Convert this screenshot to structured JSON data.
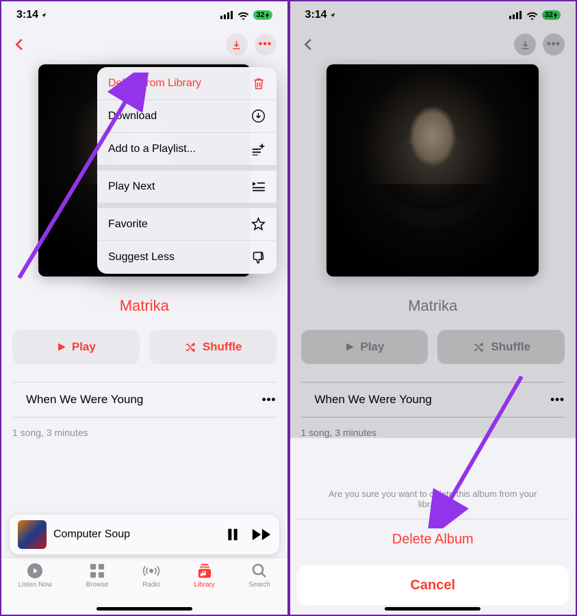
{
  "status": {
    "time": "3:14",
    "battery": "32"
  },
  "album": {
    "title": "Matrika",
    "play_label": "Play",
    "shuffle_label": "Shuffle",
    "tracks": [
      {
        "title": "When We Were Young"
      }
    ],
    "meta": "1 song, 3 minutes"
  },
  "now_playing": {
    "title": "Computer Soup"
  },
  "tabs": {
    "listen": "Listen Now",
    "browse": "Browse",
    "radio": "Radio",
    "library": "Library",
    "search": "Search"
  },
  "context_menu": {
    "delete": "Delete from Library",
    "download": "Download",
    "add_playlist": "Add to a Playlist...",
    "play_next": "Play Next",
    "favorite": "Favorite",
    "suggest_less": "Suggest Less"
  },
  "action_sheet": {
    "message": "Are you sure you want to delete this album from your library?",
    "delete": "Delete Album",
    "cancel": "Cancel"
  }
}
